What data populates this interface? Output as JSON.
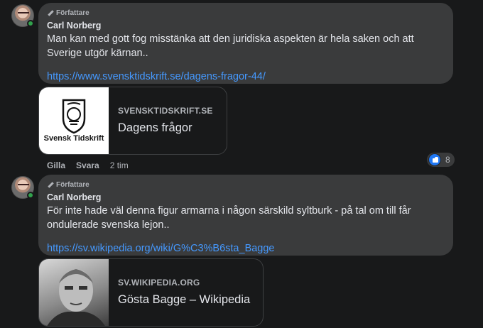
{
  "comments": [
    {
      "badge": "Författare",
      "author": "Carl Norberg",
      "text": "Man kan med gott fog misstänka att den juridiska aspekten är hela saken och att Sverige utgör kärnan..",
      "link": "https://www.svensktidskrift.se/dagens-fragor-44/",
      "preview": {
        "domain": "SVENSKTIDSKRIFT.SE",
        "title": "Dagens frågor",
        "thumb_logo_text": "Svensk Tidskrift"
      },
      "actions": {
        "like": "Gilla",
        "reply": "Svara",
        "time": "2 tim"
      },
      "reaction_count": "8",
      "reaction_icon": "like-icon",
      "accent_color": "#2078f4"
    },
    {
      "badge": "Författare",
      "author": "Carl Norberg",
      "text": "För inte hade väl denna figur armarna i någon särskild syltburk - på tal om till får ondulerade svenska lejon..",
      "link": "https://sv.wikipedia.org/wiki/G%C3%B6sta_Bagge",
      "preview": {
        "domain": "SV.WIKIPEDIA.ORG",
        "title": "Gösta Bagge – Wikipedia"
      }
    }
  ]
}
